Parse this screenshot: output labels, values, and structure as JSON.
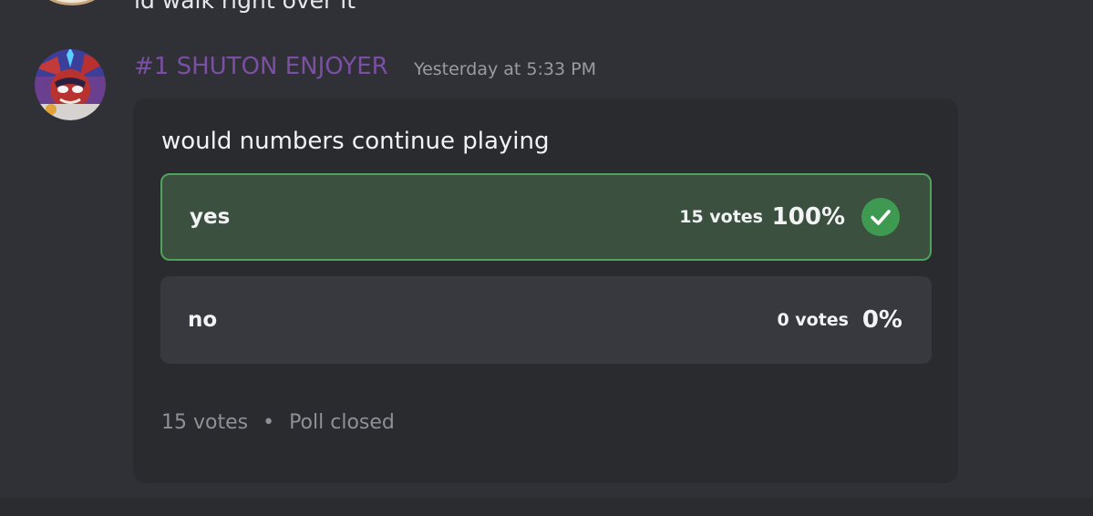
{
  "previous_message": {
    "text": "id walk right over it"
  },
  "message": {
    "author": "#1 SHUTON ENJOYER",
    "timestamp": "Yesterday at 5:33 PM",
    "avatar_icon": "avatar-image",
    "author_color": "#7b4fa3"
  },
  "poll": {
    "question": "would numbers continue playing",
    "answers": [
      {
        "label": "yes",
        "votes": "15 votes",
        "percent": "100%",
        "winner": true,
        "icon": "check-icon"
      },
      {
        "label": "no",
        "votes": "0 votes",
        "percent": "0%",
        "winner": false
      }
    ],
    "footer": {
      "total_votes": "15 votes",
      "separator": "•",
      "status": "Poll closed"
    },
    "colors": {
      "winner_fill": "#3c5040",
      "winner_border": "#4fa35c",
      "check": "#3e9a51"
    }
  }
}
